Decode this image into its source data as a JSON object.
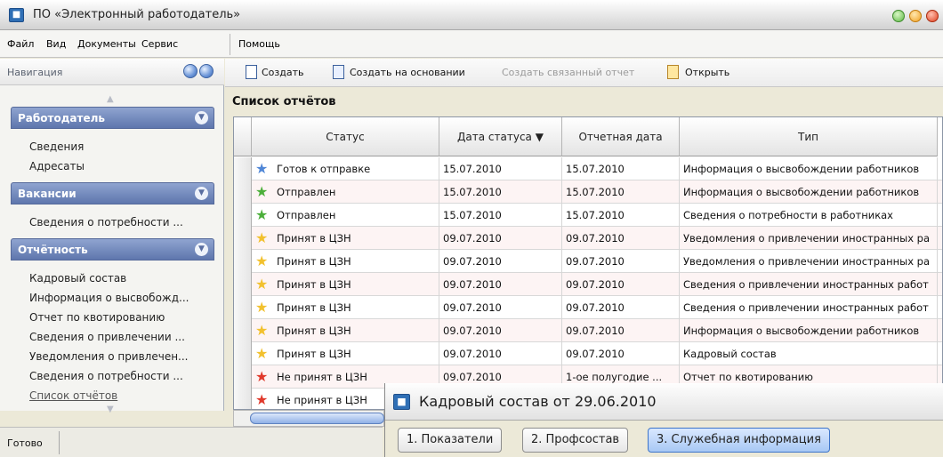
{
  "app": {
    "title": "ПО «Электронный работодатель»"
  },
  "menu": [
    "Файл",
    "Вид",
    "Документы",
    "Сервис",
    "Помощь"
  ],
  "nav": {
    "header": "Навигация",
    "groups": [
      {
        "label": "Работодатель",
        "items": [
          "Сведения",
          "Адресаты"
        ]
      },
      {
        "label": "Вакансии",
        "items": [
          "Сведения о потребности ..."
        ]
      },
      {
        "label": "Отчётность",
        "items": [
          "Кадровый состав",
          "Информация о высвобожд...",
          "Отчет по квотированию",
          "Сведения о привлечении ...",
          "Уведомления о привлечен...",
          "Сведения о потребности ...",
          "Список отчётов"
        ]
      }
    ]
  },
  "status": "Готово",
  "toolbar": {
    "create": "Создать",
    "create_based": "Создать на основании",
    "create_linked": "Создать связанный отчет",
    "open": "Открыть"
  },
  "list": {
    "title": "Список отчётов",
    "columns": [
      "Статус",
      "Дата статуса ▼",
      "Отчетная дата",
      "Тип"
    ],
    "rows": [
      {
        "status": "Готов к отправке",
        "status_kind": "ready",
        "date": "15.07.2010",
        "report_date": "15.07.2010",
        "type": "Информация о высвобождении работников"
      },
      {
        "status": "Отправлен",
        "status_kind": "sent",
        "date": "15.07.2010",
        "report_date": "15.07.2010",
        "type": "Информация о высвобождении работников"
      },
      {
        "status": "Отправлен",
        "status_kind": "sent",
        "date": "15.07.2010",
        "report_date": "15.07.2010",
        "type": "Сведения о потребности в работниках"
      },
      {
        "status": "Принят в ЦЗН",
        "status_kind": "accepted",
        "date": "09.07.2010",
        "report_date": "09.07.2010",
        "type": "Уведомления о привлечении иностранных ра"
      },
      {
        "status": "Принят в ЦЗН",
        "status_kind": "accepted",
        "date": "09.07.2010",
        "report_date": "09.07.2010",
        "type": "Уведомления о привлечении иностранных ра"
      },
      {
        "status": "Принят в ЦЗН",
        "status_kind": "accepted",
        "date": "09.07.2010",
        "report_date": "09.07.2010",
        "type": "Сведения о привлечении иностранных работ"
      },
      {
        "status": "Принят в ЦЗН",
        "status_kind": "accepted",
        "date": "09.07.2010",
        "report_date": "09.07.2010",
        "type": "Сведения о привлечении иностранных работ"
      },
      {
        "status": "Принят в ЦЗН",
        "status_kind": "accepted",
        "date": "09.07.2010",
        "report_date": "09.07.2010",
        "type": "Информация о высвобождении работников"
      },
      {
        "status": "Принят в ЦЗН",
        "status_kind": "accepted",
        "date": "09.07.2010",
        "report_date": "09.07.2010",
        "type": "Кадровый состав"
      },
      {
        "status": "Не принят в ЦЗН",
        "status_kind": "rejected",
        "date": "09.07.2010",
        "report_date": "1-ое полугодие ...",
        "type": "Отчет по квотированию"
      },
      {
        "status": "Не принят в ЦЗН",
        "status_kind": "rejected",
        "date": "",
        "report_date": "",
        "type": ""
      }
    ]
  },
  "dialog": {
    "title": "Кадровый состав от 29.06.2010",
    "tabs": [
      "1. Показатели",
      "2. Профсостав",
      "3. Служебная информация"
    ],
    "active_tab": 2
  },
  "colors": {
    "nav_group": "#6f86bd",
    "tab_active": "#a8c8f4",
    "star_ready": "#4f86d6",
    "star_sent": "#4caf3a",
    "star_accepted": "#f2c12e",
    "star_rejected": "#e0392b"
  }
}
